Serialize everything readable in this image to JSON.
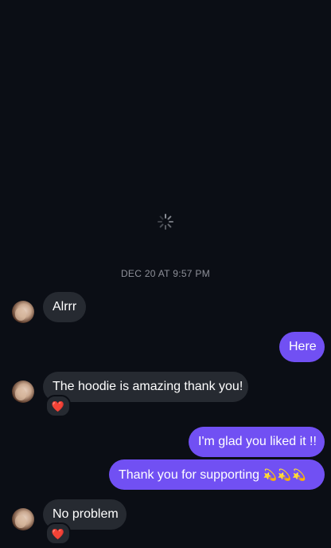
{
  "thread": {
    "timestamp": "DEC 20 AT 9:57 PM"
  },
  "messages": [
    {
      "id": "m1",
      "direction": "incoming",
      "text": "Alrrr"
    },
    {
      "id": "m2",
      "direction": "outgoing",
      "text": "Here"
    },
    {
      "id": "m3",
      "direction": "incoming",
      "text": "The hoodie is amazing thank you!",
      "reaction": "❤️"
    },
    {
      "id": "m4",
      "direction": "outgoing",
      "text": "I'm glad you liked it !!"
    },
    {
      "id": "m5",
      "direction": "outgoing",
      "text": "Thank you for supporting",
      "emoji": "💫💫💫"
    },
    {
      "id": "m6",
      "direction": "incoming",
      "text": "No problem",
      "reaction": "❤️"
    }
  ],
  "colors": {
    "background": "#0b0e15",
    "incoming_bubble": "#262a31",
    "outgoing_bubble": "#7150f3",
    "timestamp_text": "#8e9099"
  },
  "icons": {
    "loading": "spinner-icon",
    "avatar": "contact-avatar",
    "reaction": "heart-emoji"
  }
}
